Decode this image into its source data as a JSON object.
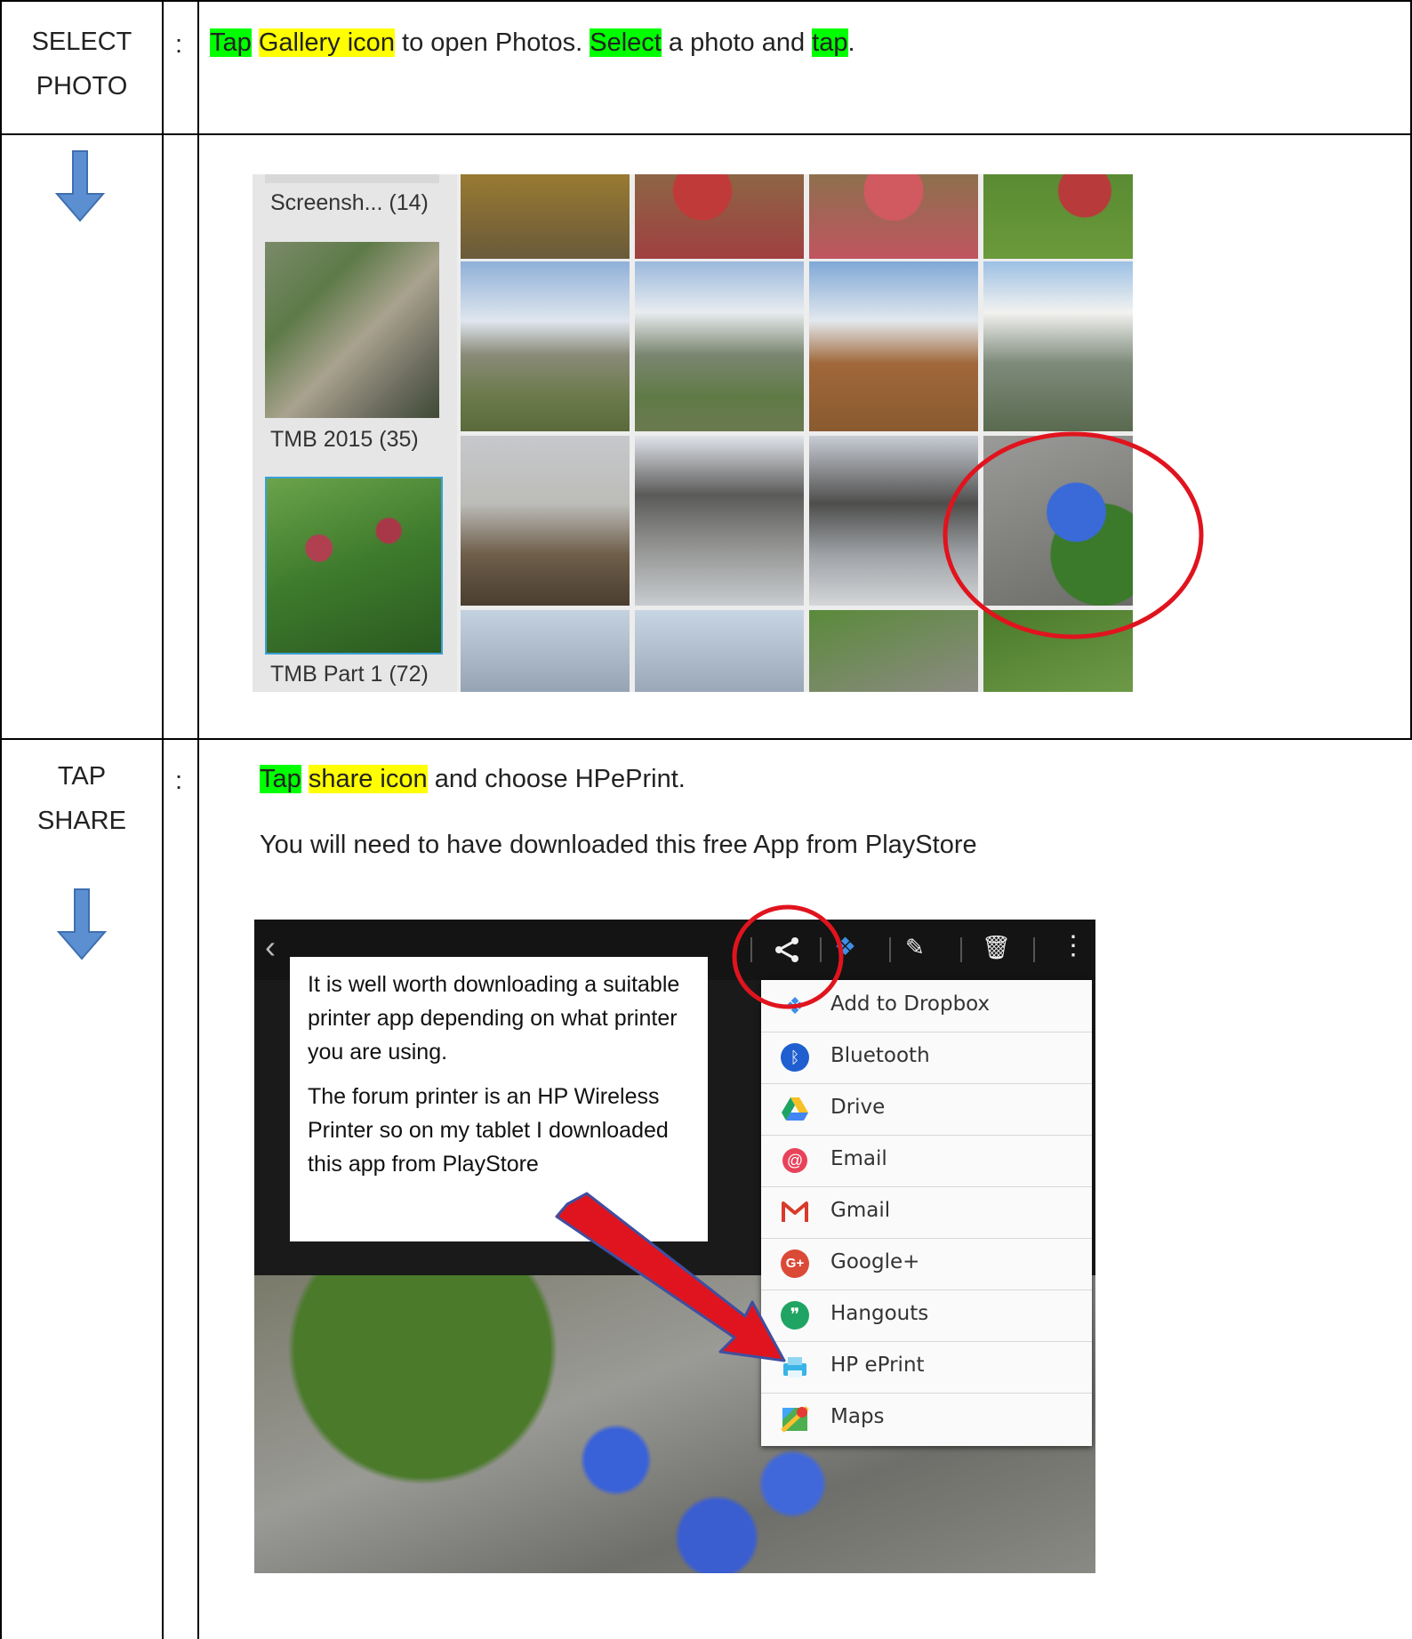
{
  "steps": [
    {
      "label_line1": "SELECT",
      "label_line2": "PHOTO",
      "colon": ":",
      "instruction": {
        "tap": "Tap",
        "gallery_icon": "Gallery icon",
        "text1": " to open Photos. ",
        "select": "Select",
        "text2": " a photo and ",
        "tap2": "tap",
        "text3": "."
      }
    },
    {
      "label_line1": "TAP",
      "label_line2": "SHARE",
      "colon": ":",
      "instruction": {
        "tap": "Tap",
        "share_icon": "share icon",
        "text1": " and choose HPePrint.",
        "line2": "You will need to have downloaded this free App from PlayStore"
      }
    }
  ],
  "gallery": {
    "albums": [
      {
        "label": "Screensh... (14)"
      },
      {
        "label": "TMB 2015 (35)"
      },
      {
        "label": "TMB Part 1 (72)"
      }
    ]
  },
  "share_screen": {
    "note_p1": "It is well worth downloading a suitable printer app depending on what printer you are using.",
    "note_p2": "The forum printer is an HP Wireless Printer so on my tablet I downloaded this app from PlayStore",
    "menu_items": [
      {
        "label": "Add to Dropbox",
        "icon": "dropbox-icon"
      },
      {
        "label": "Bluetooth",
        "icon": "bluetooth-icon"
      },
      {
        "label": "Drive",
        "icon": "drive-icon"
      },
      {
        "label": "Email",
        "icon": "email-icon"
      },
      {
        "label": "Gmail",
        "icon": "gmail-icon"
      },
      {
        "label": "Google+",
        "icon": "google-plus-icon"
      },
      {
        "label": "Hangouts",
        "icon": "hangouts-icon"
      },
      {
        "label": "HP ePrint",
        "icon": "hp-eprint-icon"
      },
      {
        "label": "Maps",
        "icon": "maps-icon"
      }
    ]
  },
  "colors": {
    "highlight_green": "#00ff00",
    "highlight_yellow": "#ffff00",
    "annotation_red": "#e0141e",
    "arrow_blue": "#5b8fd1"
  }
}
